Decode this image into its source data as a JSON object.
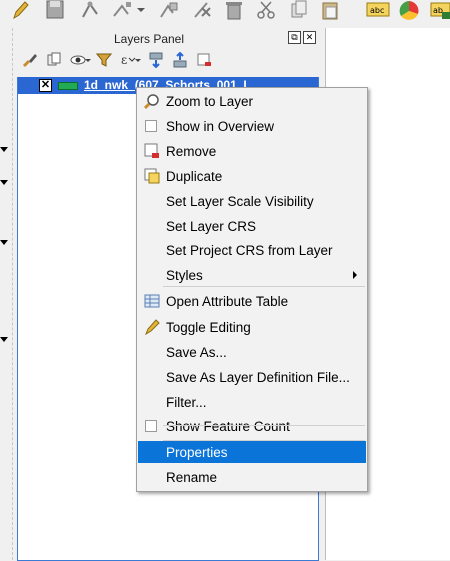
{
  "panel": {
    "title": "Layers Panel",
    "float_glyph": "⧉",
    "close_glyph": "✕"
  },
  "layer": {
    "name": "1d_nwk_(607_Schorts_001_L",
    "checkbox_glyph": "✕"
  },
  "menu": {
    "items": [
      {
        "label": "Zoom to Layer",
        "icon": "zoom-icon"
      },
      {
        "label": "Show in Overview",
        "icon": "checkbox"
      },
      {
        "label": "Remove",
        "icon": "remove-layer-icon"
      },
      {
        "label": "Duplicate",
        "icon": "duplicate-layer-icon"
      },
      {
        "label": "Set Layer Scale Visibility"
      },
      {
        "label": "Set Layer CRS"
      },
      {
        "label": "Set Project CRS from Layer"
      },
      {
        "label": "Styles",
        "submenu": true
      },
      {
        "label": "Open Attribute Table",
        "icon": "attribute-table-icon"
      },
      {
        "label": "Toggle Editing",
        "icon": "pencil-icon"
      },
      {
        "label": "Save As..."
      },
      {
        "label": "Save As Layer Definition File..."
      },
      {
        "label": "Filter..."
      },
      {
        "label": "Show Feature Count",
        "icon": "checkbox"
      },
      {
        "label": "Properties",
        "selected": true
      },
      {
        "label": "Rename"
      }
    ]
  },
  "toolbar": {
    "icons": [
      "pencil-icon",
      "save-icon",
      "node-tool-icon",
      "move-feature-icon",
      "add-feature-icon",
      "delete-part-icon",
      "delete-icon",
      "cut-icon",
      "copy-icon",
      "paste-icon",
      "label-abc-icon",
      "pie-chart-icon",
      "label-pin-icon"
    ],
    "abc_text": "abc",
    "abc_pin_text": "ab"
  },
  "colors": {
    "selection": "#0a74d9",
    "layer_row": "#2b67d3",
    "layer_swatch": "#22aa55"
  }
}
